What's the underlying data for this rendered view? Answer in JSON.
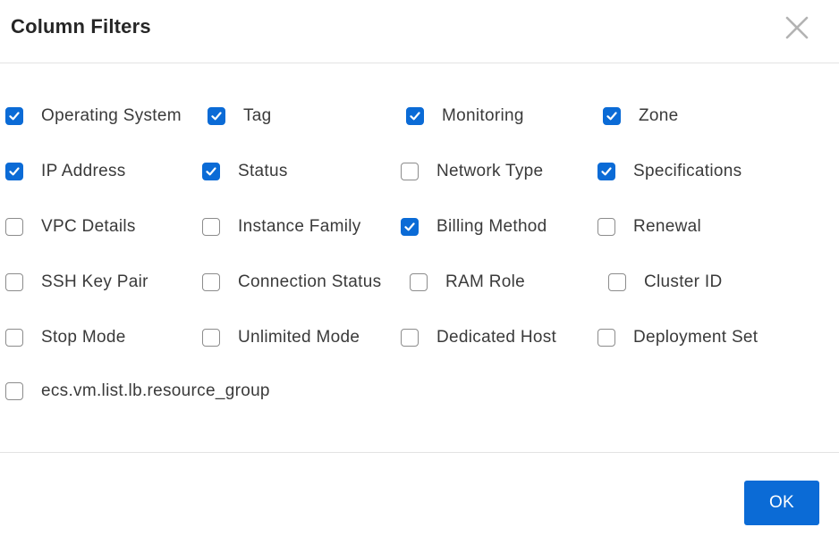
{
  "dialog": {
    "title": "Column Filters",
    "ok_label": "OK"
  },
  "options": [
    {
      "label": "Operating System",
      "checked": true
    },
    {
      "label": "Tag",
      "checked": true
    },
    {
      "label": "Monitoring",
      "checked": true
    },
    {
      "label": "Zone",
      "checked": true
    },
    {
      "label": "IP Address",
      "checked": true
    },
    {
      "label": "Status",
      "checked": true
    },
    {
      "label": "Network Type",
      "checked": false
    },
    {
      "label": "Specifications",
      "checked": true
    },
    {
      "label": "VPC Details",
      "checked": false
    },
    {
      "label": "Instance Family",
      "checked": false
    },
    {
      "label": "Billing Method",
      "checked": true
    },
    {
      "label": "Renewal",
      "checked": false
    },
    {
      "label": "SSH Key Pair",
      "checked": false
    },
    {
      "label": "Connection Status",
      "checked": false
    },
    {
      "label": "RAM Role",
      "checked": false
    },
    {
      "label": "Cluster ID",
      "checked": false
    },
    {
      "label": "Stop Mode",
      "checked": false
    },
    {
      "label": "Unlimited Mode",
      "checked": false
    },
    {
      "label": "Dedicated Host",
      "checked": false
    },
    {
      "label": "Deployment Set",
      "checked": false
    },
    {
      "label": "ecs.vm.list.lb.resource_group",
      "checked": false
    }
  ],
  "colors": {
    "accent": "#0b6bd6",
    "checkbox_border": "#8c8c8c"
  },
  "icons": {
    "close": "close-icon",
    "check": "check-icon"
  }
}
